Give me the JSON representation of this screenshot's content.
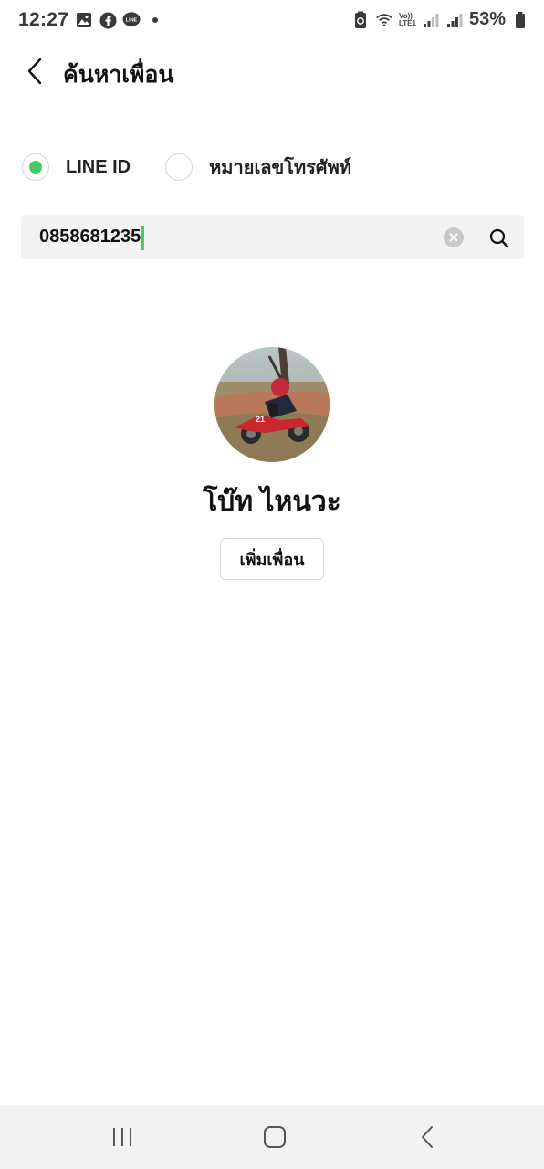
{
  "status_bar": {
    "time": "12:27",
    "left_icons": [
      "gallery-icon",
      "facebook-icon",
      "line-icon",
      "dot-icon"
    ],
    "line_icon_text": "LINE",
    "volte_line1": "Vo))",
    "volte_line2": "LTE1",
    "battery_percent": "53%"
  },
  "header": {
    "title": "ค้นหาเพื่อน"
  },
  "search_type": {
    "options": [
      {
        "label": "LINE ID",
        "selected": true
      },
      {
        "label": "หมายเลขโทรศัพท์",
        "selected": false
      }
    ]
  },
  "search": {
    "value": "0858681235"
  },
  "result": {
    "name": "โบ๊ท ไหนวะ",
    "add_friend_label": "เพิ่มเพื่อน"
  },
  "colors": {
    "accent": "#4cc764",
    "search_bg": "#f3f3f3",
    "nav_bg": "#f2f2f2"
  }
}
